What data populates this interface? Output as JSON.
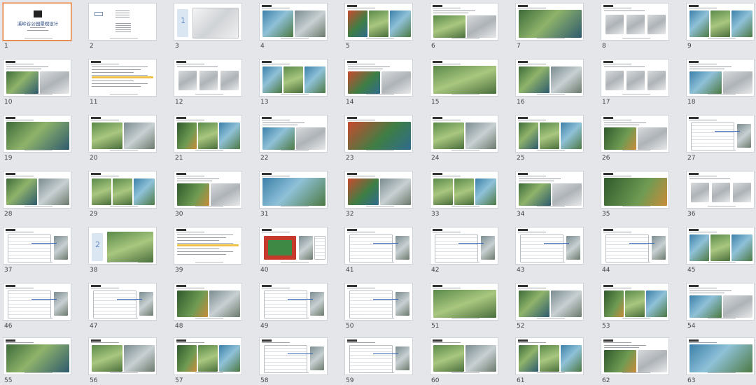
{
  "window": {
    "title": ""
  },
  "cover": {
    "title": "溪岭谷公园景观设计"
  },
  "section_badges": {
    "s3": "1",
    "s38": "2"
  },
  "selected_slide": 1,
  "slides": [
    {
      "number": "1",
      "kind": "cover"
    },
    {
      "number": "2",
      "kind": "toc"
    },
    {
      "number": "3",
      "kind": "section"
    },
    {
      "number": "4",
      "kind": "photos"
    },
    {
      "number": "5",
      "kind": "photos"
    },
    {
      "number": "6",
      "kind": "photos"
    },
    {
      "number": "7",
      "kind": "photos"
    },
    {
      "number": "8",
      "kind": "sketch"
    },
    {
      "number": "9",
      "kind": "photos"
    },
    {
      "number": "10",
      "kind": "photos"
    },
    {
      "number": "11",
      "kind": "text"
    },
    {
      "number": "12",
      "kind": "sketch"
    },
    {
      "number": "13",
      "kind": "photos"
    },
    {
      "number": "14",
      "kind": "photos"
    },
    {
      "number": "15",
      "kind": "photos"
    },
    {
      "number": "16",
      "kind": "photos"
    },
    {
      "number": "17",
      "kind": "sketch"
    },
    {
      "number": "18",
      "kind": "photos"
    },
    {
      "number": "19",
      "kind": "photos"
    },
    {
      "number": "20",
      "kind": "photos"
    },
    {
      "number": "21",
      "kind": "photos"
    },
    {
      "number": "22",
      "kind": "photos"
    },
    {
      "number": "23",
      "kind": "photos"
    },
    {
      "number": "24",
      "kind": "photos"
    },
    {
      "number": "25",
      "kind": "photos"
    },
    {
      "number": "26",
      "kind": "photos"
    },
    {
      "number": "27",
      "kind": "plan"
    },
    {
      "number": "28",
      "kind": "photos"
    },
    {
      "number": "29",
      "kind": "photos"
    },
    {
      "number": "30",
      "kind": "photos"
    },
    {
      "number": "31",
      "kind": "photos"
    },
    {
      "number": "32",
      "kind": "photos"
    },
    {
      "number": "33",
      "kind": "photos"
    },
    {
      "number": "34",
      "kind": "photos"
    },
    {
      "number": "35",
      "kind": "photos"
    },
    {
      "number": "36",
      "kind": "sketch"
    },
    {
      "number": "37",
      "kind": "plan"
    },
    {
      "number": "38",
      "kind": "section"
    },
    {
      "number": "39",
      "kind": "text"
    },
    {
      "number": "40",
      "kind": "court"
    },
    {
      "number": "41",
      "kind": "plan"
    },
    {
      "number": "42",
      "kind": "plan"
    },
    {
      "number": "43",
      "kind": "plan"
    },
    {
      "number": "44",
      "kind": "plan"
    },
    {
      "number": "45",
      "kind": "photos"
    },
    {
      "number": "46",
      "kind": "plan"
    },
    {
      "number": "47",
      "kind": "plan"
    },
    {
      "number": "48",
      "kind": "photos"
    },
    {
      "number": "49",
      "kind": "plan"
    },
    {
      "number": "50",
      "kind": "plan"
    },
    {
      "number": "51",
      "kind": "photos"
    },
    {
      "number": "52",
      "kind": "photos"
    },
    {
      "number": "53",
      "kind": "photos"
    },
    {
      "number": "54",
      "kind": "photos"
    },
    {
      "number": "55",
      "kind": "photos"
    },
    {
      "number": "56",
      "kind": "photos"
    },
    {
      "number": "57",
      "kind": "photos"
    },
    {
      "number": "58",
      "kind": "plan"
    },
    {
      "number": "59",
      "kind": "plan"
    },
    {
      "number": "60",
      "kind": "photos"
    },
    {
      "number": "61",
      "kind": "photos"
    },
    {
      "number": "62",
      "kind": "photos"
    },
    {
      "number": "63",
      "kind": "photos"
    }
  ]
}
